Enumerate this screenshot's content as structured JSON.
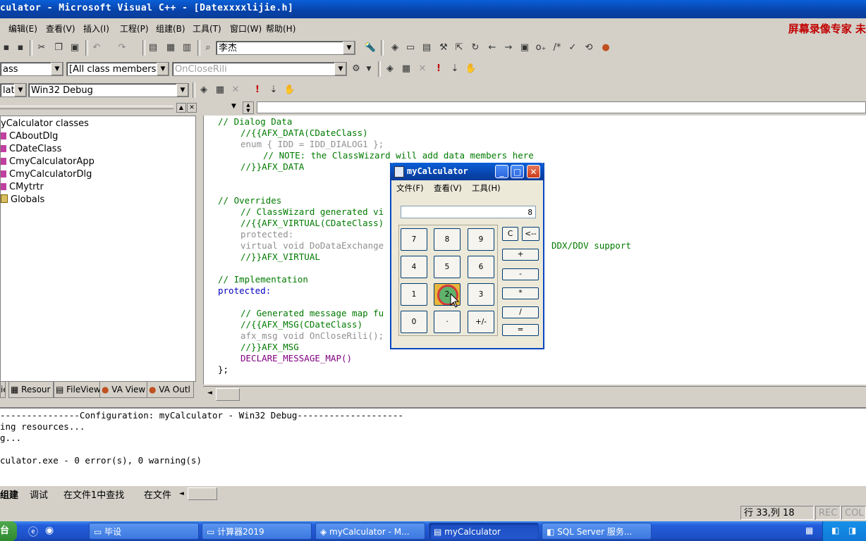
{
  "window": {
    "title": "culator - Microsoft Visual C++ - [Datexxxxlijie.h]"
  },
  "menu": {
    "items": [
      "编辑(E)",
      "查看(V)",
      "插入(I)",
      "工程(P)",
      "组建(B)",
      "工具(T)",
      "窗口(W)",
      "帮助(H)"
    ],
    "brand": "屏幕录像专家 未"
  },
  "toolbar": {
    "find_combo": "李杰",
    "class_combo": "ass",
    "members_combo": "[All class members]",
    "function_combo": "OnCloseRili",
    "project_combo": "latc",
    "config_combo": "Win32 Debug"
  },
  "workspace": {
    "root": "yCalculator classes",
    "classes": [
      "CAboutDlg",
      "CDateClass",
      "CmyCalculatorApp",
      "CmyCalculatorDlg",
      "CMytrtr",
      "Globals"
    ],
    "tabs": [
      "Resour",
      "FileView",
      "VA View",
      "VA Outl"
    ],
    "class_view_tab": "ie"
  },
  "editor": {
    "lines": [
      {
        "text": "// Dialog Data",
        "style": "cm",
        "indent": 0
      },
      {
        "text": "//{{AFX_DATA(CDateClass)",
        "style": "cm",
        "indent": 4
      },
      {
        "text": "enum { IDD = IDD_DIALOG1 };",
        "style": "gr",
        "indent": 4
      },
      {
        "text": "// NOTE: the ClassWizard will add data members here",
        "style": "cm",
        "indent": 8
      },
      {
        "text": "//}}AFX_DATA",
        "style": "cm",
        "indent": 4
      },
      {
        "text": "",
        "style": "",
        "indent": 0
      },
      {
        "text": "",
        "style": "",
        "indent": 0
      },
      {
        "text": "// Overrides",
        "style": "cm",
        "indent": 0
      },
      {
        "text": "// ClassWizard generated vi",
        "style": "cm",
        "indent": 4
      },
      {
        "text": "//{{AFX_VIRTUAL(CDateClass)",
        "style": "cm",
        "indent": 4
      },
      {
        "text": "protected:",
        "style": "gr",
        "indent": 4
      },
      {
        "text": "virtual void DoDataExchange",
        "style": "gr",
        "indent": 4
      },
      {
        "text": "//}}AFX_VIRTUAL",
        "style": "cm",
        "indent": 4
      },
      {
        "text": "",
        "style": "",
        "indent": 0
      },
      {
        "text": "// Implementation",
        "style": "cm",
        "indent": 0
      },
      {
        "text": "protected:",
        "style": "kw",
        "indent": 0
      },
      {
        "text": "",
        "style": "",
        "indent": 0
      },
      {
        "text": "// Generated message map fu",
        "style": "cm",
        "indent": 4
      },
      {
        "text": "//{{AFX_MSG(CDateClass)",
        "style": "cm",
        "indent": 4
      },
      {
        "text": "afx_msg void OnCloseRili();",
        "style": "gr",
        "indent": 4
      },
      {
        "text": "//}}AFX_MSG",
        "style": "cm",
        "indent": 4
      },
      {
        "text": "DECLARE_MESSAGE_MAP()",
        "style": "mac",
        "indent": 4
      },
      {
        "text": "};",
        "style": "",
        "indent": 0
      }
    ],
    "side_fragment": "DDX/DDV support"
  },
  "output": {
    "lines": [
      "---------------Configuration: myCalculator - Win32 Debug--------------------",
      "ing resources...",
      "g...",
      "",
      "culator.exe - 0 error(s), 0 warning(s)"
    ],
    "tabs": [
      "组建",
      "调试",
      "在文件1中查找",
      "在文件"
    ]
  },
  "status": {
    "position": "行 33,列 18",
    "rec": "REC",
    "col": "COL"
  },
  "taskbar": {
    "start_fragment": "台",
    "buttons": [
      {
        "label": "毕设"
      },
      {
        "label": "计算器2019"
      },
      {
        "label": "myCalculator - M..."
      },
      {
        "label": "myCalculator"
      },
      {
        "label": "SQL Server 服务..."
      }
    ]
  },
  "calculator": {
    "title": "myCalculator",
    "menu": [
      "文件(F)",
      "查看(V)",
      "工具(H)"
    ],
    "display": "8",
    "keys": [
      "7",
      "8",
      "9",
      "4",
      "5",
      "6",
      "1",
      "2",
      "3",
      "0",
      "·",
      "+/-"
    ],
    "clear": "C",
    "backspace": "<--",
    "ops": [
      "+",
      "-",
      "*",
      "/",
      "="
    ]
  }
}
